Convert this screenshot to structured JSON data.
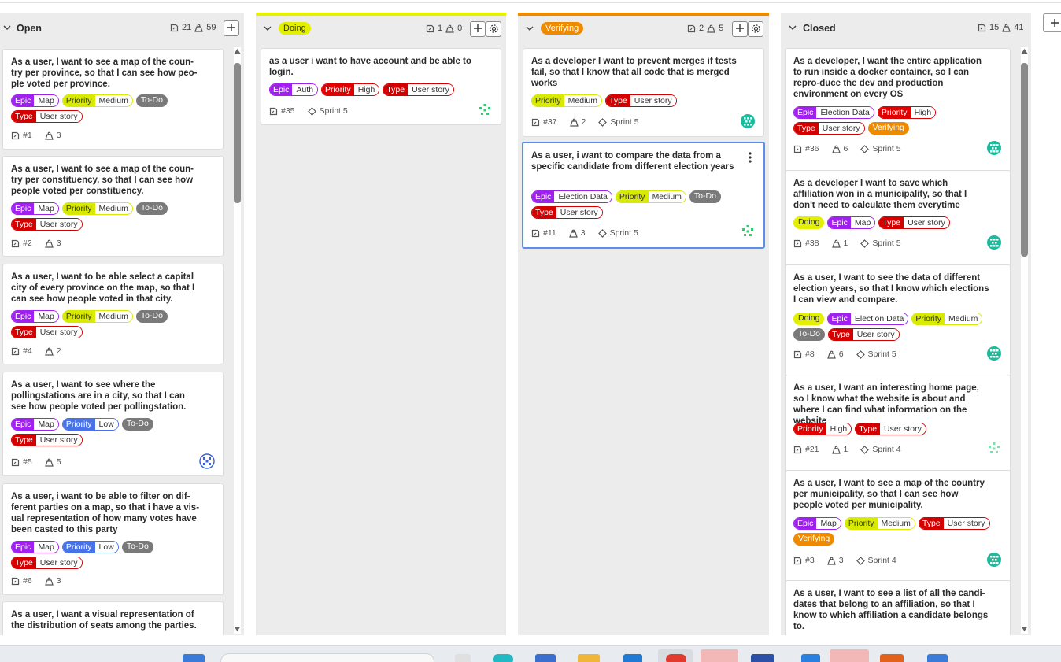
{
  "columns": [
    {
      "id": "open",
      "title": "Open",
      "pill": "",
      "count_issues": "21",
      "count_points": "59",
      "cards": [
        {
          "title": "As a user, I want to see a map of the coun-try per province, so that I can see how peo-ple voted per province.",
          "tags": [
            {
              "k": "Epic",
              "v": "Map",
              "cls": "epic"
            },
            {
              "k": "Priority",
              "v": "Medium",
              "cls": "prio-med"
            },
            {
              "k": "To-Do",
              "cls": "todo"
            },
            {
              "k": "Type",
              "v": "User story",
              "cls": "type"
            }
          ],
          "id": "#1",
          "points": "3",
          "sprint": "",
          "avatar": ""
        },
        {
          "title": "As a user, I want to see a map of the coun-try per constituency, so that I can see how people voted per constituency.",
          "tags": [
            {
              "k": "Epic",
              "v": "Map",
              "cls": "epic"
            },
            {
              "k": "Priority",
              "v": "Medium",
              "cls": "prio-med"
            },
            {
              "k": "To-Do",
              "cls": "todo"
            },
            {
              "k": "Type",
              "v": "User story",
              "cls": "type"
            }
          ],
          "id": "#2",
          "points": "3",
          "sprint": "",
          "avatar": ""
        },
        {
          "title": "As a user, I want to be able select a capital city of every province on the map, so that I can see how people voted in that city.",
          "tags": [
            {
              "k": "Epic",
              "v": "Map",
              "cls": "epic"
            },
            {
              "k": "Priority",
              "v": "Medium",
              "cls": "prio-med"
            },
            {
              "k": "To-Do",
              "cls": "todo"
            },
            {
              "k": "Type",
              "v": "User story",
              "cls": "type"
            }
          ],
          "id": "#4",
          "points": "2",
          "sprint": "",
          "avatar": ""
        },
        {
          "title": "As a user, I want to see where the pollingstations are in a city, so that I can see how people voted per pollingstation.",
          "tags": [
            {
              "k": "Epic",
              "v": "Map",
              "cls": "epic"
            },
            {
              "k": "Priority",
              "v": "Low",
              "cls": "prio-low"
            },
            {
              "k": "To-Do",
              "cls": "todo"
            },
            {
              "k": "Type",
              "v": "User story",
              "cls": "type"
            }
          ],
          "id": "#5",
          "points": "5",
          "sprint": "",
          "avatar": "blue"
        },
        {
          "title": "As a user, i want to be able to filter on dif-ferent parties on a map, so that i have a vis-ual representation of how many votes have been casted to this party",
          "tags": [
            {
              "k": "Epic",
              "v": "Map",
              "cls": "epic"
            },
            {
              "k": "Priority",
              "v": "Low",
              "cls": "prio-low"
            },
            {
              "k": "To-Do",
              "cls": "todo"
            },
            {
              "k": "Type",
              "v": "User story",
              "cls": "type"
            }
          ],
          "id": "#6",
          "points": "3",
          "sprint": "",
          "avatar": ""
        },
        {
          "title": "As a user, I want a visual representation of the distribution of seats among the parties.",
          "tags": [],
          "id": "",
          "points": "",
          "sprint": "",
          "avatar": ""
        }
      ]
    },
    {
      "id": "doing",
      "title": "",
      "pill": "Doing",
      "count_issues": "1",
      "count_points": "0",
      "cards": [
        {
          "title": "as a user i want to have account and be able to login.",
          "tags": [
            {
              "k": "Epic",
              "v": "Auth",
              "cls": "epic"
            },
            {
              "k": "Priority",
              "v": "High",
              "cls": "prio-high"
            },
            {
              "k": "Type",
              "v": "User story",
              "cls": "type"
            }
          ],
          "id": "#35",
          "points": "",
          "sprint": "Sprint 5",
          "avatar": "green"
        }
      ]
    },
    {
      "id": "verifying",
      "title": "",
      "pill": "Verifying",
      "count_issues": "2",
      "count_points": "5",
      "cards": [
        {
          "title": "As a developer I want to prevent merges if tests fail, so that I know that all code that is merged works",
          "tags": [
            {
              "k": "Priority",
              "v": "Medium",
              "cls": "prio-med"
            },
            {
              "k": "Type",
              "v": "User story",
              "cls": "type"
            }
          ],
          "id": "#37",
          "points": "2",
          "sprint": "Sprint 5",
          "avatar": "teal"
        },
        {
          "title": "As a user, i want to compare the data from a specific candidate from different election years",
          "tags": [
            {
              "k": "Epic",
              "v": "Election Data",
              "cls": "epic"
            },
            {
              "k": "Priority",
              "v": "Medium",
              "cls": "prio-med"
            },
            {
              "k": "To-Do",
              "cls": "todo"
            },
            {
              "k": "Type",
              "v": "User story",
              "cls": "type"
            }
          ],
          "id": "#11",
          "points": "3",
          "sprint": "Sprint 5",
          "avatar": "green"
        }
      ]
    },
    {
      "id": "closed",
      "title": "Closed",
      "pill": "",
      "count_issues": "15",
      "count_points": "41",
      "cards": [
        {
          "title": "As a developer, I want the entire application to run inside a docker container, so I can repro-duce the dev and production environment on every OS",
          "tags": [
            {
              "k": "Epic",
              "v": "Election Data",
              "cls": "epic"
            },
            {
              "k": "Priority",
              "v": "High",
              "cls": "prio-high"
            },
            {
              "k": "Type",
              "v": "User story",
              "cls": "type"
            },
            {
              "k": "Verifying",
              "cls": "verifying"
            }
          ],
          "id": "#36",
          "points": "6",
          "sprint": "Sprint 5",
          "avatar": "teal"
        },
        {
          "title": "As a developer I want to save which affiliation won in a municipality, so that I don't need to calculate them everytime",
          "tags": [
            {
              "k": "Doing",
              "cls": "doing"
            },
            {
              "k": "Epic",
              "v": "Map",
              "cls": "epic"
            },
            {
              "k": "Type",
              "v": "User story",
              "cls": "type"
            }
          ],
          "id": "#38",
          "points": "1",
          "sprint": "Sprint 5",
          "avatar": "teal"
        },
        {
          "title": "As a user, I want to see the data of different election years, so that I know which elections I can view and compare.",
          "tags": [
            {
              "k": "Doing",
              "cls": "doing"
            },
            {
              "k": "Epic",
              "v": "Election Data",
              "cls": "epic"
            },
            {
              "k": "Priority",
              "v": "Medium",
              "cls": "prio-med"
            },
            {
              "k": "To-Do",
              "cls": "todo"
            },
            {
              "k": "Type",
              "v": "User story",
              "cls": "type"
            }
          ],
          "id": "#8",
          "points": "6",
          "sprint": "Sprint 5",
          "avatar": "teal"
        },
        {
          "title": "As a user, I want an interesting home page, so I know what the website is about and where I can find what information on the website",
          "tags": [
            {
              "k": "Priority",
              "v": "High",
              "cls": "prio-high"
            },
            {
              "k": "Type",
              "v": "User story",
              "cls": "type"
            }
          ],
          "id": "#21",
          "points": "1",
          "sprint": "Sprint 4",
          "avatar": "green"
        },
        {
          "title": "As a user, I want to see a map of the country per municipality, so that I can see how people voted per municipality.",
          "tags": [
            {
              "k": "Epic",
              "v": "Map",
              "cls": "epic"
            },
            {
              "k": "Priority",
              "v": "Medium",
              "cls": "prio-med"
            },
            {
              "k": "Type",
              "v": "User story",
              "cls": "type"
            },
            {
              "k": "Verifying",
              "cls": "verifying"
            }
          ],
          "id": "#3",
          "points": "3",
          "sprint": "Sprint 4",
          "avatar": "teal"
        },
        {
          "title": "As a user, I want to see a list of all the candi-dates that belong to an affiliation, so that I know to which affiliation a candidate belongs to.",
          "tags": [],
          "id": "",
          "points": "",
          "sprint": "",
          "avatar": ""
        }
      ]
    }
  ],
  "colors": {
    "epic": "#a020f0",
    "priority_medium": "#d7ea00",
    "priority_high": "#e00000",
    "priority_low": "#4a72e8",
    "type": "#d40000",
    "todo": "#7a7a7a",
    "doing": "#e3f000",
    "verifying": "#ee8a00",
    "selected_border": "#5c8ee8"
  },
  "icons": {
    "collapse": "chevron-down-icon",
    "issues": "issue-icon",
    "points": "weight-icon",
    "sprint": "diamond-icon",
    "add": "plus-icon",
    "settings": "gear-icon",
    "more": "kebab-icon"
  }
}
